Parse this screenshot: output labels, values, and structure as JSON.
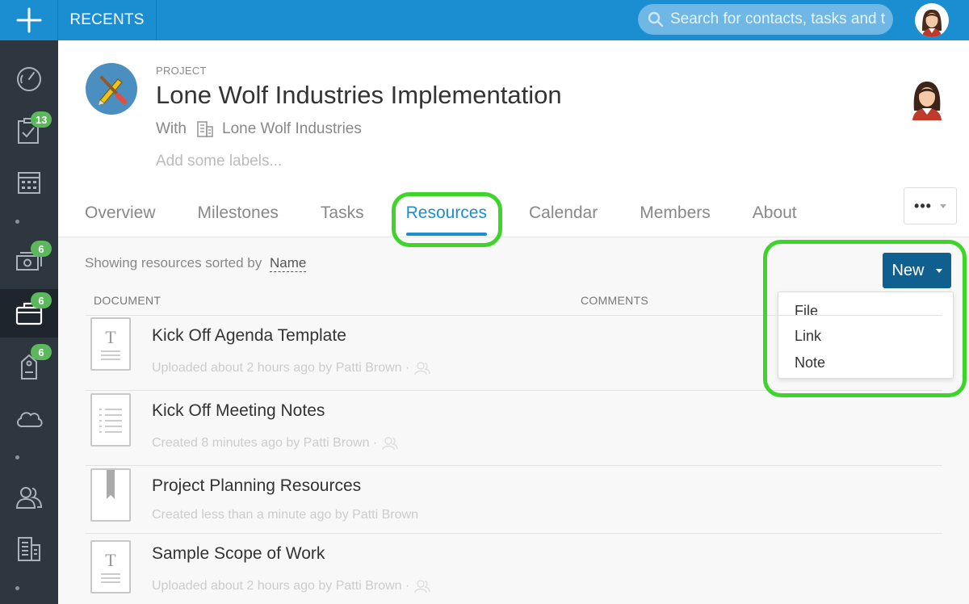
{
  "topbar": {
    "add_icon": "plus-icon",
    "recents_label": "RECENTS",
    "search_placeholder": "Search for contacts, tasks and t",
    "search_icon": "search-icon",
    "avatar_icon": "user-avatar-icon"
  },
  "sidebar": {
    "items": [
      {
        "icon": "dashboard-gauge-icon"
      },
      {
        "icon": "tasks-checkbox-icon",
        "badge": "13"
      },
      {
        "icon": "calendar-icon"
      },
      {
        "icon": "money-opportunity-icon",
        "badge": "6"
      },
      {
        "icon": "briefcase-project-icon",
        "badge": "6",
        "active": true
      },
      {
        "icon": "tag-case-icon",
        "badge": "6"
      },
      {
        "icon": "cloud-icon"
      },
      {
        "icon": "people-icon"
      },
      {
        "icon": "building-icon"
      }
    ]
  },
  "project": {
    "kind": "PROJECT",
    "title": "Lone Wolf Industries Implementation",
    "with_label": "With",
    "company": "Lone Wolf Industries",
    "labels_placeholder": "Add some labels..."
  },
  "tabs": [
    {
      "label": "Overview"
    },
    {
      "label": "Milestones"
    },
    {
      "label": "Tasks"
    },
    {
      "label": "Resources",
      "active": true
    },
    {
      "label": "Calendar"
    },
    {
      "label": "Members"
    },
    {
      "label": "About"
    }
  ],
  "more_label": "•••",
  "resources": {
    "sort_prefix": "Showing resources sorted by",
    "sort_by": "Name",
    "new_button": "New",
    "new_menu": [
      "File",
      "Link",
      "Note"
    ],
    "columns": {
      "document": "DOCUMENT",
      "comments": "COMMENTS"
    },
    "rows": [
      {
        "name": "Kick Off Agenda Template",
        "meta": "Uploaded about 2 hours ago by Patti Brown ·",
        "icon": "text-document-icon"
      },
      {
        "name": "Kick Off Meeting Notes",
        "meta": "Created 8 minutes ago by Patti Brown ·",
        "icon": "note-document-icon"
      },
      {
        "name": "Project Planning Resources",
        "meta": "Created less than a minute ago by Patti Brown",
        "icon": "bookmark-link-icon"
      },
      {
        "name": "Sample Scope of Work",
        "meta": "Uploaded about 2 hours ago by Patti Brown ·",
        "icon": "text-document-icon"
      }
    ]
  },
  "colors": {
    "topbar": "#1b8dd1",
    "sidebar": "#2e3640",
    "accent": "#1b8dd1",
    "new_button": "#0f5f8f",
    "badge": "#5cb85c",
    "highlight": "#3fd42b"
  }
}
